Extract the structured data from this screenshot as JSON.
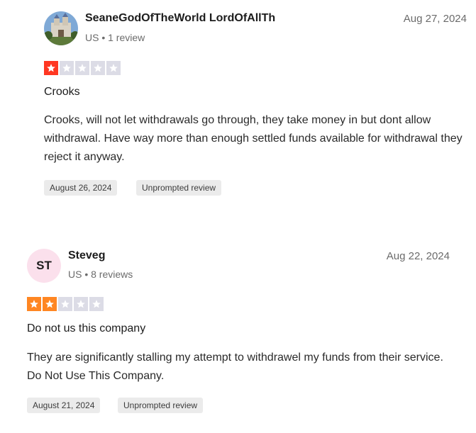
{
  "colors": {
    "star_one": "#ff3722",
    "star_two": "#ff8622",
    "star_empty": "#dcdce6"
  },
  "reviews": [
    {
      "reviewer_name": "SeaneGodOfTheWorld LordOfAllTh",
      "reviewer_meta": "US • 1 review",
      "avatar": "photo",
      "date": "Aug 27, 2024",
      "rating": 1,
      "title": "Crooks",
      "body": "Crooks, will not let withdrawals go through, they take money in but dont allow withdrawal. Have way more than enough settled funds available for withdrawal they reject it anyway.",
      "experience_date": "August 26, 2024",
      "review_type": "Unprompted review"
    },
    {
      "reviewer_name": "Steveg",
      "reviewer_meta": "US • 8 reviews",
      "avatar_initials": "ST",
      "date": "Aug 22, 2024",
      "rating": 2,
      "title": "Do not us this company",
      "body": "They are significantly stalling my attempt to withdrawel my funds from their service. Do Not Use This Company.",
      "experience_date": "August 21, 2024",
      "review_type": "Unprompted review"
    }
  ]
}
